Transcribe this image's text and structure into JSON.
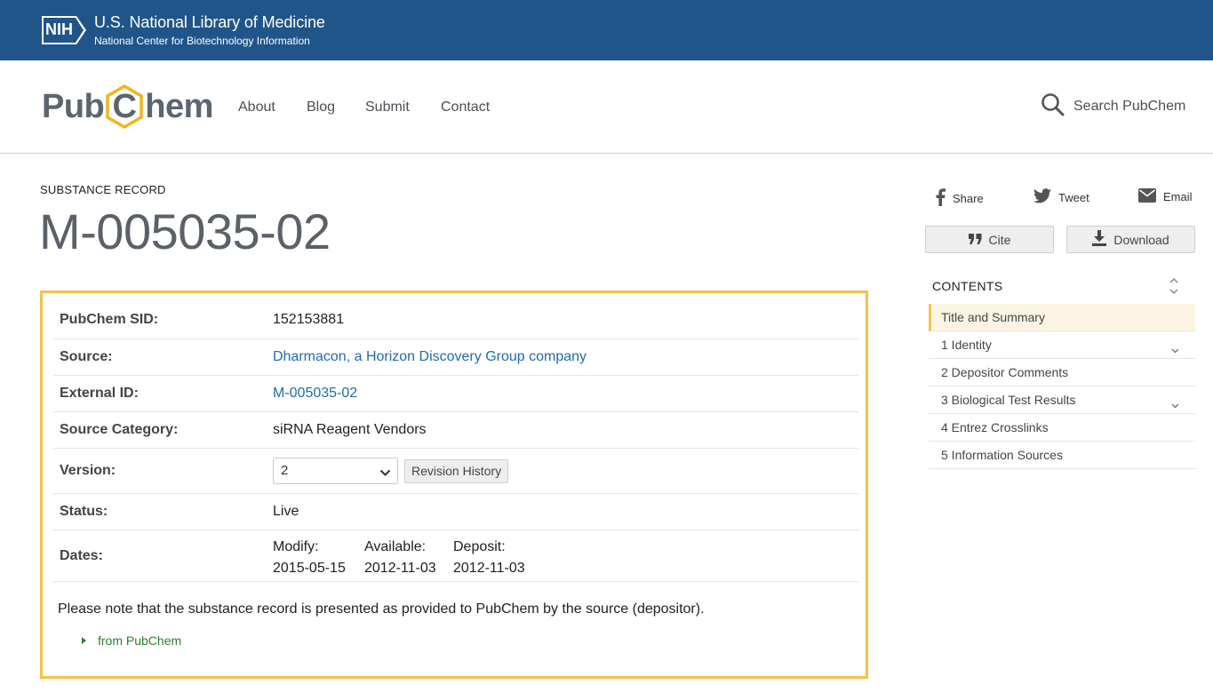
{
  "nih": {
    "logo_text": "NIH",
    "title": "U.S. National Library of Medicine",
    "subtitle": "National Center for Biotechnology Information"
  },
  "header": {
    "logo": {
      "part1": "Pub",
      "part2": "C",
      "part3": "hem"
    },
    "nav": [
      "About",
      "Blog",
      "Submit",
      "Contact"
    ],
    "search_label": "Search PubChem"
  },
  "record": {
    "type_label": "SUBSTANCE RECORD",
    "title": "M-005035-02"
  },
  "summary": {
    "sid": {
      "label": "PubChem SID:",
      "value": "152153881"
    },
    "source": {
      "label": "Source:",
      "value": "Dharmacon, a Horizon Discovery Group company"
    },
    "external_id": {
      "label": "External ID:",
      "value": "M-005035-02"
    },
    "source_category": {
      "label": "Source Category:",
      "value": "siRNA Reagent Vendors"
    },
    "version": {
      "label": "Version:",
      "selected": "2",
      "revision_button": "Revision History"
    },
    "status": {
      "label": "Status:",
      "value": "Live"
    },
    "dates": {
      "label": "Dates:",
      "modify": {
        "label": "Modify:",
        "value": "2015-05-15"
      },
      "available": {
        "label": "Available:",
        "value": "2012-11-03"
      },
      "deposit": {
        "label": "Deposit:",
        "value": "2012-11-03"
      }
    },
    "note": "Please note that the substance record is presented as provided to PubChem by the source (depositor).",
    "from_label": "from PubChem"
  },
  "rail": {
    "share": "Share",
    "tweet": "Tweet",
    "email": "Email",
    "cite": "Cite",
    "download": "Download",
    "contents_header": "CONTENTS",
    "toc": [
      {
        "label": "Title and Summary"
      },
      {
        "label": "1 Identity"
      },
      {
        "label": "2 Depositor Comments"
      },
      {
        "label": "3 Biological Test Results"
      },
      {
        "label": "4 Entrez Crosslinks"
      },
      {
        "label": "5 Information Sources"
      }
    ]
  },
  "colors": {
    "nih_blue": "#20558a",
    "accent_yellow": "#f3c24a",
    "link_blue": "#1f6ab0",
    "green": "#2e7d32"
  }
}
